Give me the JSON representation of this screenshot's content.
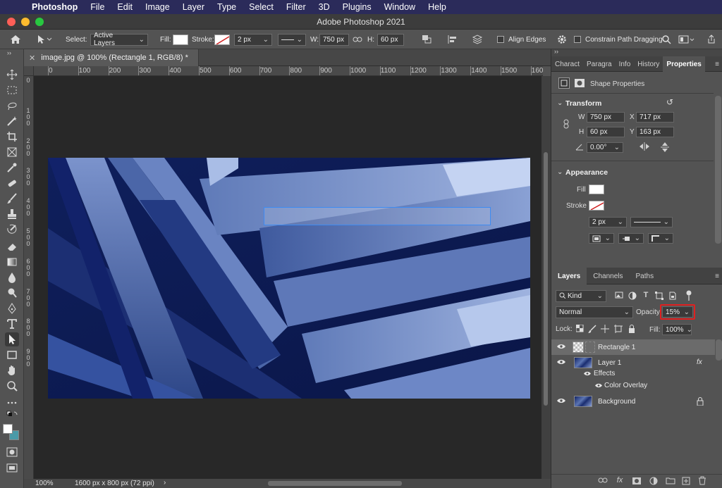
{
  "menubar": {
    "app_name": "Photoshop",
    "items": [
      "File",
      "Edit",
      "Image",
      "Layer",
      "Type",
      "Select",
      "Filter",
      "3D",
      "Plugins",
      "Window",
      "Help"
    ]
  },
  "window": {
    "title": "Adobe Photoshop 2021"
  },
  "options_bar": {
    "select_label": "Select:",
    "select_value": "Active Layers",
    "fill_label": "Fill:",
    "stroke_label": "Stroke:",
    "stroke_width": "2 px",
    "w_label": "W:",
    "w_value": "750 px",
    "h_label": "H:",
    "h_value": "60 px",
    "align_edges_label": "Align Edges",
    "constrain_label": "Constrain Path Dragging",
    "fill_color": "#ffffff"
  },
  "document": {
    "tab_title": "image.jpg @ 100% (Rectangle 1, RGB/8) *",
    "ruler_labels": [
      "0",
      "100",
      "200",
      "300",
      "400",
      "500",
      "600",
      "700",
      "800",
      "900",
      "1000",
      "1100",
      "1200",
      "1300",
      "1400",
      "1500",
      "160"
    ],
    "vruler_labels": [
      "0",
      "1\n0\n0",
      "2\n0\n0",
      "3\n0\n0",
      "4\n0\n0",
      "5\n0\n0",
      "6\n0\n0",
      "7\n0\n0",
      "8\n0\n0",
      "9\n0\n0"
    ]
  },
  "status_bar": {
    "zoom": "100%",
    "doc_info": "1600 px x 800 px (72 ppi)"
  },
  "properties_panel": {
    "tabs": [
      "Charact",
      "Paragra",
      "Info",
      "History",
      "Properties"
    ],
    "active_tab": "Properties",
    "shape_properties_label": "Shape Properties",
    "transform_label": "Transform",
    "w_label": "W",
    "w_value": "750 px",
    "x_label": "X",
    "x_value": "717 px",
    "h_label": "H",
    "h_value": "60 px",
    "y_label": "Y",
    "y_value": "163 px",
    "angle_value": "0.00°",
    "appearance_label": "Appearance",
    "fill_label": "Fill",
    "stroke_label": "Stroke",
    "stroke_width": "2 px"
  },
  "layers_panel": {
    "tabs": [
      "Layers",
      "Channels",
      "Paths"
    ],
    "active_tab": "Layers",
    "kind_label": "Kind",
    "blend_mode": "Normal",
    "opacity_label": "Opacity:",
    "opacity_value": "15%",
    "lock_label": "Lock:",
    "fill_label": "Fill:",
    "fill_value": "100%",
    "highlight_color": "#e02020",
    "layers": [
      {
        "name": "Rectangle 1",
        "selected": true
      },
      {
        "name": "Layer 1",
        "fx": "fx"
      },
      {
        "name": "Effects"
      },
      {
        "name": "Color Overlay"
      },
      {
        "name": "Background",
        "locked": true
      }
    ]
  }
}
